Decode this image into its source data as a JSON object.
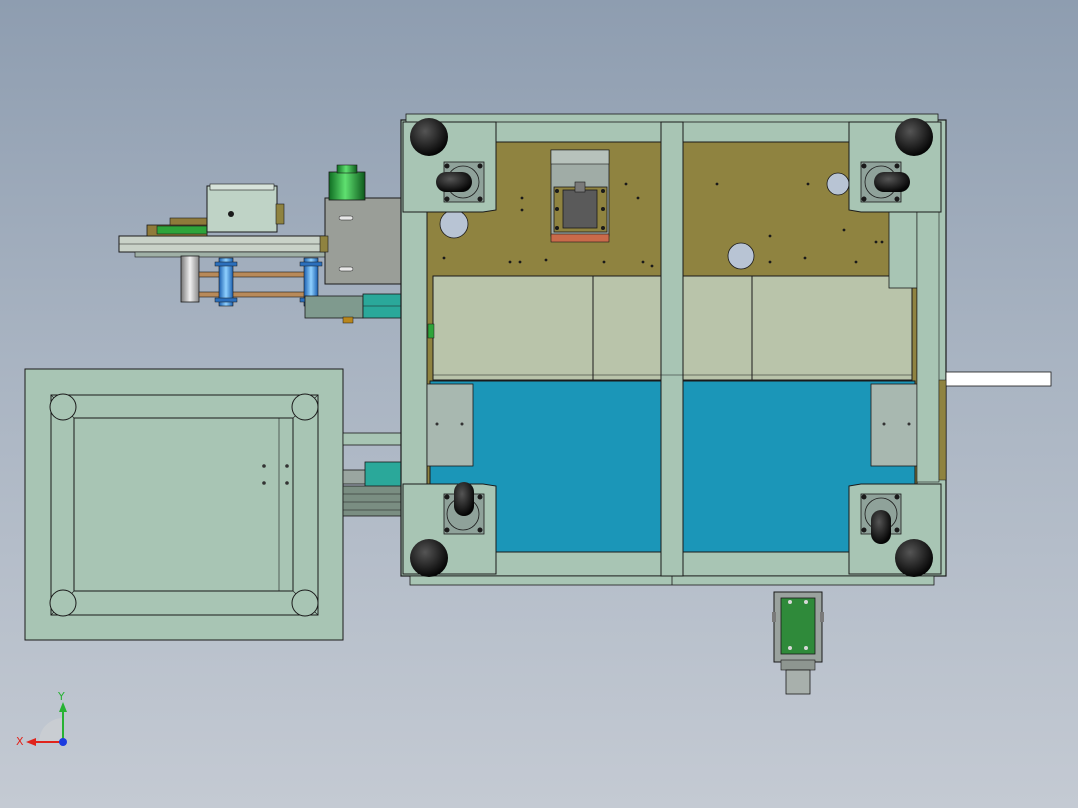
{
  "triad": {
    "x_label": "X",
    "y_label": "Y",
    "colors": {
      "x": "#e0241c",
      "y": "#27b233",
      "z": "#1c3ce0"
    }
  },
  "colors": {
    "background_top": "#8e9db0",
    "background_bottom": "#c4cad3",
    "frame": "#a8c5b4",
    "plate": "#8f8340",
    "blue_tray": "#1b96b8",
    "light_panel": "#b9c4aa",
    "pale_panel": "#bfd3c6",
    "green_motor": "#2ea43a",
    "teal_part": "#2aa89a",
    "edge": "#1a1a1a"
  },
  "icons": [
    "caster-wheel-icon",
    "stepper-motor-icon",
    "cylinder-icon",
    "coordinate-triad-icon"
  ]
}
